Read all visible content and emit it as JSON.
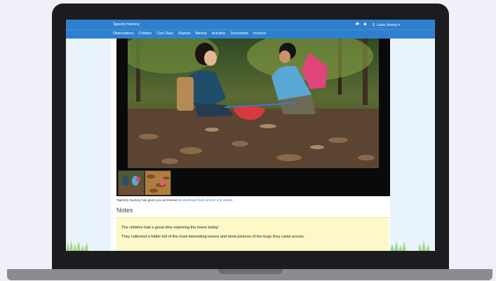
{
  "app": {
    "title": "Tapestry Nursery",
    "user_name": "Luisa Jessop ▾"
  },
  "nav": {
    "items": [
      "Observations",
      "Children",
      "Care Diary",
      "Reports",
      "Memos",
      "Activities",
      "Documents",
      "Invoices"
    ]
  },
  "caption": {
    "prefix": "Tapestry Nursery has given you permission to ",
    "link": "download these photos and videos",
    "suffix": "."
  },
  "notes": {
    "title": "Notes",
    "line1": "The children had a great time exploring the forest today!",
    "line2": "They collected a folder full of the most interesting leaves and drew pictures of the bugs they came across."
  },
  "icons": {
    "chat": "chat-icon",
    "bell": "bell-icon",
    "user": "user-icon"
  },
  "colors": {
    "brand": "#2f7fcf",
    "notes_bg": "#fdf8c7",
    "page_bg": "#f1eff7"
  }
}
